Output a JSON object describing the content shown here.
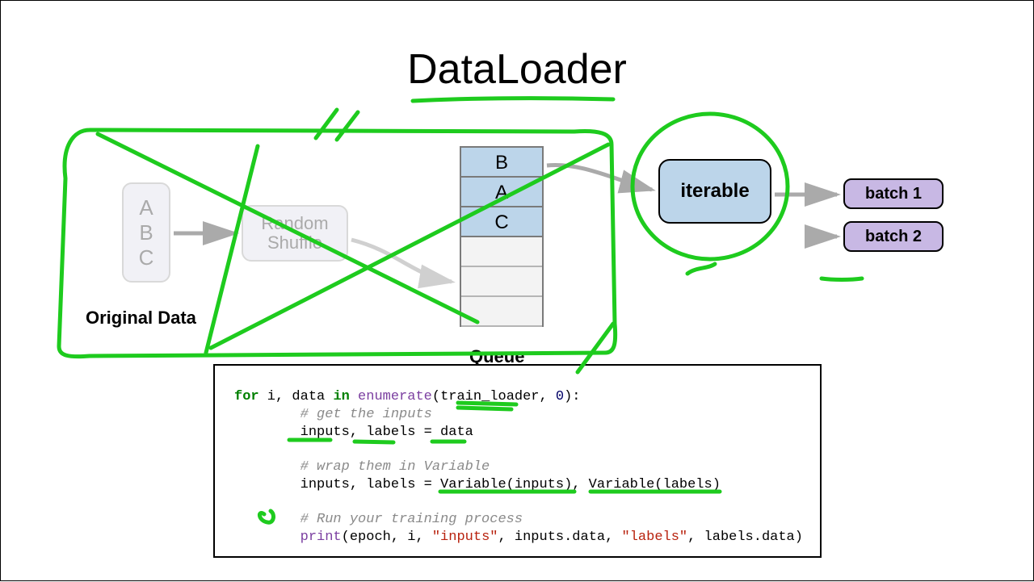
{
  "title": "DataLoader",
  "original_data": {
    "label": "Original Data",
    "items": [
      "A",
      "B",
      "C"
    ]
  },
  "shuffle": {
    "line1": "Random",
    "line2": "Shuffle"
  },
  "queue": {
    "label": "Queue",
    "filled": [
      "B",
      "A",
      "C"
    ],
    "empty_slots": 3
  },
  "iterable": {
    "label": "iterable"
  },
  "batches": [
    {
      "label": "batch 1"
    },
    {
      "label": "batch  2"
    }
  ],
  "code": {
    "l1_pre": "for",
    "l1_mid1": " i, data ",
    "l1_in": "in",
    "l1_mid2": " ",
    "l1_fn": "enumerate",
    "l1_post": "(train_loader, ",
    "l1_num": "0",
    "l1_end": "):",
    "l2": "        # get the inputs",
    "l3": "        inputs, labels = data",
    "l4": "        # wrap them in Variable",
    "l5": "        inputs, labels = Variable(inputs), Variable(labels)",
    "l6": "        # Run your training process",
    "l7_pre": "        ",
    "l7_fn": "print",
    "l7_a": "(epoch, i, ",
    "l7_s1": "\"inputs\"",
    "l7_b": ", inputs.data, ",
    "l7_s2": "\"labels\"",
    "l7_c": ", labels.data)"
  }
}
